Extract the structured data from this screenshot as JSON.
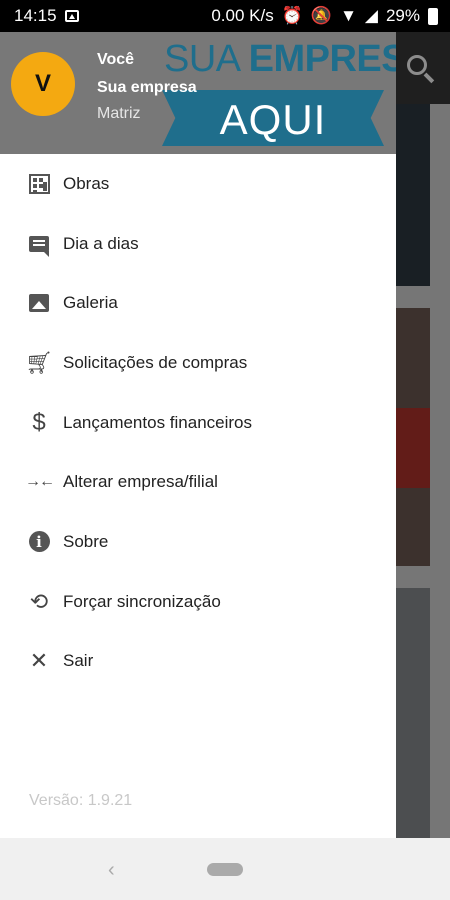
{
  "status_bar": {
    "time": "14:15",
    "network_speed": "0.00 K/s",
    "battery": "29%",
    "icons": [
      "image-icon",
      "alarm-icon",
      "mute-icon",
      "wifi-icon",
      "signal-icon",
      "battery-icon"
    ]
  },
  "drawer": {
    "header": {
      "avatar_letter": "V",
      "user_name": "Você",
      "company": "Sua empresa",
      "branch": "Matriz",
      "logo": {
        "line1_thin": "SUA ",
        "line1_bold": "EMPRESA",
        "line2": "AQUI"
      }
    },
    "menu": [
      {
        "label": "Obras",
        "icon": "building-icon"
      },
      {
        "label": "Dia a dias",
        "icon": "comment-icon"
      },
      {
        "label": "Galeria",
        "icon": "image-icon"
      },
      {
        "label": "Solicitações de compras",
        "icon": "cart-icon"
      },
      {
        "label": "Lançamentos financeiros",
        "icon": "dollar-icon"
      },
      {
        "label": "Alterar empresa/filial",
        "icon": "swap-icon"
      },
      {
        "label": "Sobre",
        "icon": "info-icon"
      },
      {
        "label": "Forçar sincronização",
        "icon": "sync-icon"
      },
      {
        "label": "Sair",
        "icon": "close-icon"
      }
    ],
    "version": "Versão: 1.9.21"
  },
  "colors": {
    "avatar": "#f4a911",
    "header_bg": "#787878",
    "logo_blue": "#1f6e8c"
  }
}
